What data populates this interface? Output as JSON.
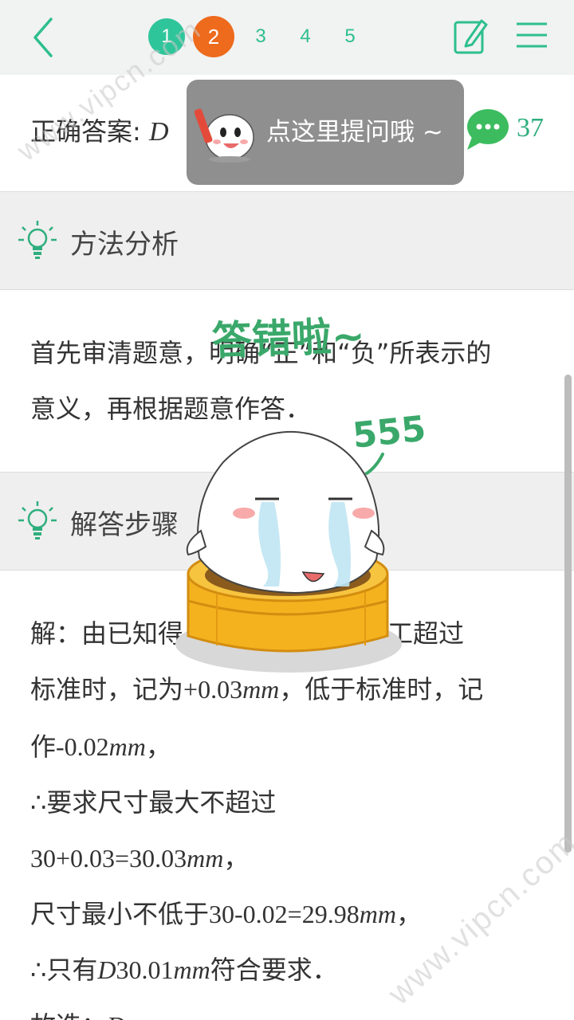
{
  "topbar": {
    "pages": [
      "1",
      "2",
      "3",
      "4",
      "5"
    ],
    "current_page": "2"
  },
  "answer": {
    "label": "正确答案: ",
    "value": "D",
    "comment_count": "37"
  },
  "tooltip": {
    "text": "点这里提问哦 ~"
  },
  "sections": {
    "analysis": {
      "title": "方法分析",
      "lines": [
        "首先审清题意，明确“正”和“负”所表示的",
        "意义，再根据题意作答．"
      ]
    },
    "steps": {
      "title": "解答步骤",
      "l1": "解：由已知得，当零件的直径加工超过",
      "l2a": "标准时，记为",
      "l2b": "+0.03",
      "l2c": "mm",
      "l2d": "，低于标准时，记",
      "l3a": "作",
      "l3b": "-0.02",
      "l3c": "mm",
      "l3d": "，",
      "l4": "∴要求尺寸最大不超过",
      "l5a": "30+0.03=30.03",
      "l5b": "mm",
      "l5c": "，",
      "l6a": "尺寸最小不低于",
      "l6b": "30-0.02=29.98",
      "l6c": "mm",
      "l6d": "，",
      "l7a": "∴只有",
      "l7b": "D",
      "l7c": "30.01",
      "l7d": "mm",
      "l7e": "符合要求．",
      "l8a": "故选：",
      "l8b": "D"
    }
  },
  "overlay": {
    "wrong_text": "答错啦~",
    "cry_text": "555"
  },
  "watermark": "www.vipcn.com",
  "colors": {
    "accent_green": "#2fc59a",
    "current_orange": "#ee6a1c",
    "tooltip_gray": "#808080"
  }
}
